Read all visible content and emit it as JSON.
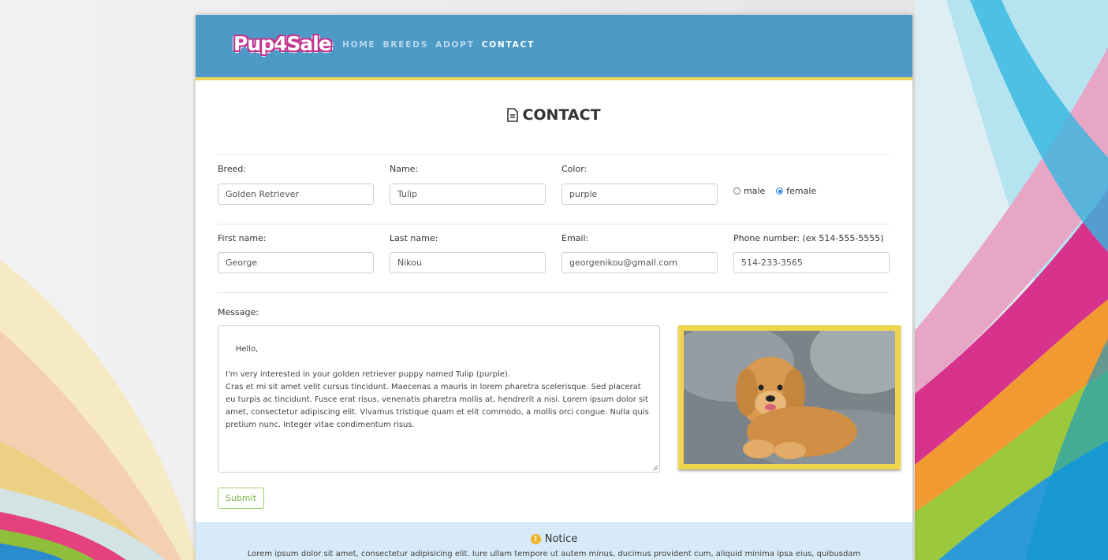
{
  "brand": {
    "logo_text": "Pup4Sale"
  },
  "nav": {
    "items": [
      "HOME",
      "BREEDS",
      "ADOPT",
      "CONTACT"
    ],
    "active": "CONTACT"
  },
  "page_title": "CONTACT",
  "pet": {
    "breed_label": "Breed:",
    "breed_value": "Golden Retriever",
    "name_label": "Name:",
    "name_value": "Tulip",
    "color_label": "Color:",
    "color_value": "purple",
    "gender_options": [
      "male",
      "female"
    ],
    "gender_selected": "female"
  },
  "owner": {
    "first_label": "First name:",
    "first_value": "George",
    "last_label": "Last name:",
    "last_value": "Nikou",
    "email_label": "Email:",
    "email_value": "georgenikou@gmail.com",
    "phone_label": "Phone number: (ex 514-555-5555)",
    "phone_value": "514-233-3565"
  },
  "message": {
    "label": "Message:",
    "value": "Hello,\n\nI'm very interested in your golden retriever puppy named Tulip (purple).\nCras et mi sit amet velit cursus tincidunt. Maecenas a mauris in lorem pharetra scelerisque. Sed placerat eu turpis ac tincidunt. Fusce erat risus, venenatis pharetra mollis at, hendrerit a nisi. Lorem ipsum dolor sit amet, consectetur adipiscing elit. Vivamus tristique quam et elit commodo, a mollis orci congue. Nulla quis pretium nunc. Integer vitae condimentum risus."
  },
  "submit_label": "Submit",
  "notice": {
    "title": "Notice",
    "text": "Lorem ipsum dolor sit amet, consectetur adipisicing elit. Iure ullam tempore ut autem minus, ducimus provident cum, aliquid minima ipsa eius, quibusdam"
  },
  "colors": {
    "navbar": "#4d9ac7",
    "accent": "#e7d35a",
    "notice_bg": "#d6eaf7"
  }
}
